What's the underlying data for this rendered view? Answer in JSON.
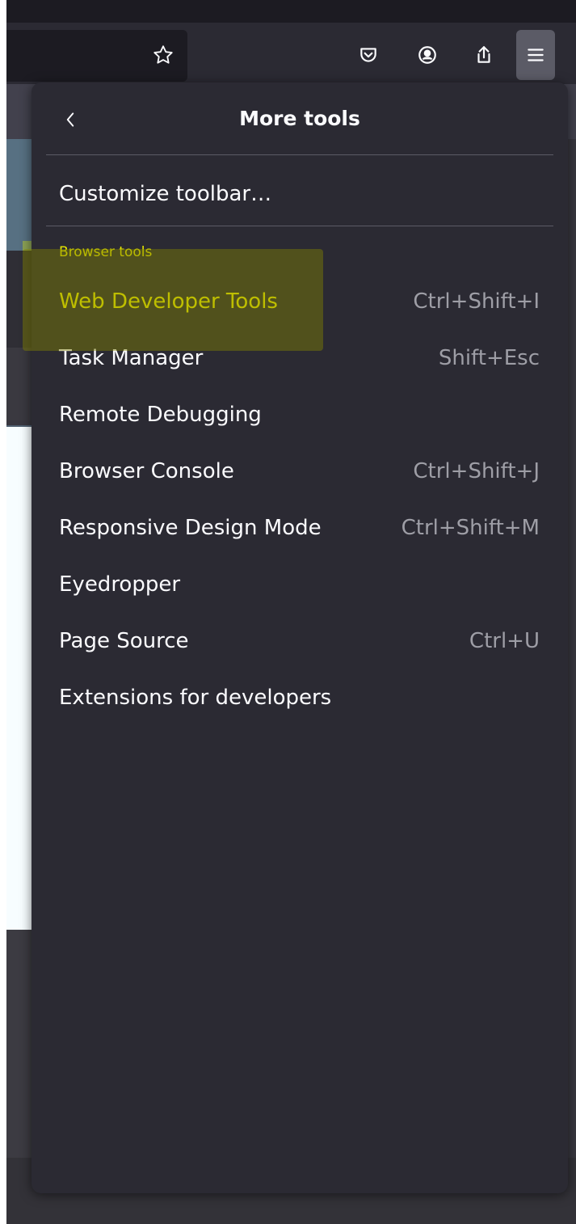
{
  "toolbar": {
    "icons": [
      "star-icon",
      "pocket-icon",
      "account-icon",
      "share-icon",
      "hamburger-menu-icon"
    ]
  },
  "panel": {
    "title": "More tools",
    "back_icon": "chevron-left-icon",
    "customize_label": "Customize toolbar…",
    "section_label": "Browser tools",
    "items": [
      {
        "label": "Web Developer Tools",
        "shortcut": "Ctrl+Shift+I",
        "highlighted": true
      },
      {
        "label": "Task Manager",
        "shortcut": "Shift+Esc"
      },
      {
        "label": "Remote Debugging",
        "shortcut": ""
      },
      {
        "label": "Browser Console",
        "shortcut": "Ctrl+Shift+J"
      },
      {
        "label": "Responsive Design Mode",
        "shortcut": "Ctrl+Shift+M"
      },
      {
        "label": "Eyedropper",
        "shortcut": ""
      },
      {
        "label": "Page Source",
        "shortcut": "Ctrl+U"
      },
      {
        "label": "Extensions for developers",
        "shortcut": ""
      }
    ]
  },
  "colors": {
    "panel_bg": "#2b2a33",
    "highlight_text": "#f0f000",
    "shortcut_text": "#9e9ea6"
  }
}
